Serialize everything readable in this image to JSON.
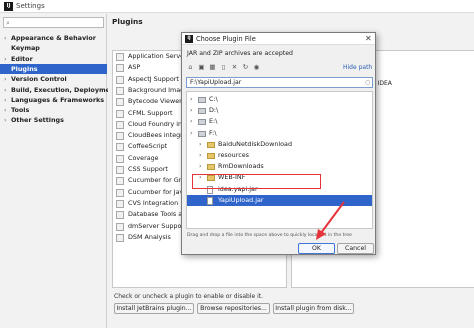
{
  "window": {
    "title": "Settings",
    "logo": "IJ"
  },
  "sidebar": {
    "search_placeholder": "",
    "items": [
      {
        "label": "Appearance & Behavior",
        "expandable": true,
        "selected": false
      },
      {
        "label": "Keymap",
        "expandable": false,
        "selected": false
      },
      {
        "label": "Editor",
        "expandable": true,
        "selected": false
      },
      {
        "label": "Plugins",
        "expandable": false,
        "selected": true
      },
      {
        "label": "Version Control",
        "expandable": true,
        "selected": false
      },
      {
        "label": "Build, Execution, Deployment",
        "expandable": true,
        "selected": false
      },
      {
        "label": "Languages & Frameworks",
        "expandable": true,
        "selected": false
      },
      {
        "label": "Tools",
        "expandable": true,
        "selected": false
      },
      {
        "label": "Other Settings",
        "expandable": true,
        "selected": false
      }
    ]
  },
  "plugins": {
    "heading": "Plugins",
    "list": [
      {
        "name": "Application Servers",
        "checked": false
      },
      {
        "name": "ASP",
        "checked": false
      },
      {
        "name": "AspectJ Support",
        "checked": false
      },
      {
        "name": "Background Image",
        "checked": false
      },
      {
        "name": "Bytecode Viewer",
        "checked": false
      },
      {
        "name": "CFML Support",
        "checked": false
      },
      {
        "name": "Cloud Foundry integr",
        "checked": false
      },
      {
        "name": "CloudBees integratic",
        "checked": false
      },
      {
        "name": "CoffeeScript",
        "checked": false
      },
      {
        "name": "Coverage",
        "checked": false
      },
      {
        "name": "CSS Support",
        "checked": false
      },
      {
        "name": "Cucumber for Groovy",
        "checked": false
      },
      {
        "name": "Cucumber for Java",
        "checked": false
      },
      {
        "name": "CVS Integration",
        "checked": false
      },
      {
        "name": "Database Tools and",
        "checked": true
      },
      {
        "name": "dmServer Support",
        "checked": true
      },
      {
        "name": "DSM Analysis",
        "checked": true
      }
    ],
    "description_fragment": "nd applications with IntelliJ IDEA",
    "hint": "Check or uncheck a plugin to enable or disable it.",
    "buttons": {
      "install_jetbrains": "Install JetBrains plugin...",
      "browse": "Browse repositories...",
      "install_disk": "Install plugin from disk..."
    }
  },
  "dialog": {
    "title": "Choose Plugin File",
    "subtitle": "JAR and ZIP archives are accepted",
    "hide_path": "Hide path",
    "path": "F:\\YapiUpload.jar",
    "tree": [
      {
        "label": "C:\\",
        "depth": 0,
        "type": "drive",
        "expandable": true,
        "selected": false
      },
      {
        "label": "D:\\",
        "depth": 0,
        "type": "drive",
        "expandable": true,
        "selected": false
      },
      {
        "label": "E:\\",
        "depth": 0,
        "type": "drive",
        "expandable": true,
        "selected": false
      },
      {
        "label": "F:\\",
        "depth": 0,
        "type": "drive",
        "expandable": true,
        "selected": false
      },
      {
        "label": "BaiduNetdiskDownload",
        "depth": 1,
        "type": "folder",
        "expandable": true,
        "selected": false
      },
      {
        "label": "resources",
        "depth": 1,
        "type": "folder",
        "expandable": true,
        "selected": false
      },
      {
        "label": "RmDownloads",
        "depth": 1,
        "type": "folder",
        "expandable": true,
        "selected": false
      },
      {
        "label": "WEB-INF",
        "depth": 1,
        "type": "folder",
        "expandable": true,
        "selected": false
      },
      {
        "label": "idea.yapi.jar",
        "depth": 1,
        "type": "jar",
        "expandable": false,
        "selected": false
      },
      {
        "label": "YapiUpload.jar",
        "depth": 1,
        "type": "jar",
        "expandable": false,
        "selected": true
      }
    ],
    "drop_hint": "Drag and drop a file into the space above to quickly locate it in the tree",
    "ok": "OK",
    "cancel": "Cancel"
  },
  "colors": {
    "selection": "#2f65ca",
    "annotation": "#e8323a",
    "link": "#2a5db0"
  }
}
